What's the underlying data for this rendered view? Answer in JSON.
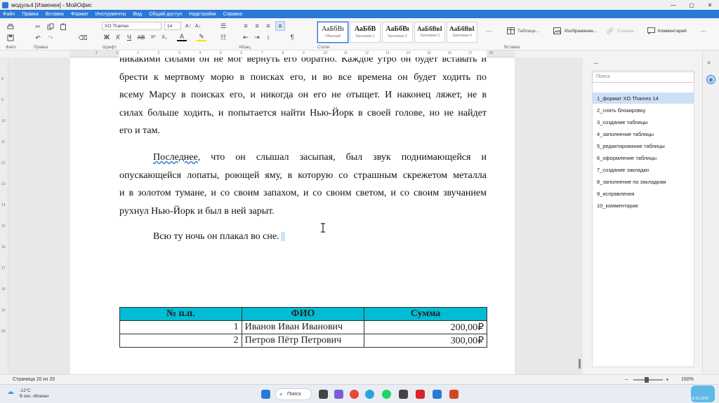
{
  "window": {
    "title": "модуль4 [Изменен] - МойОфис",
    "controls": [
      "—",
      "▢",
      "✕"
    ]
  },
  "menu": [
    "Файл",
    "Правка",
    "Вставка",
    "Формат",
    "Инструменты",
    "Вид",
    "Общий доступ",
    "Надстройки",
    "Справка"
  ],
  "ribbon": {
    "groups": {
      "file": "Файл",
      "edit": "Правка",
      "font": "Шрифт",
      "paragraph": "Абзац",
      "styles": "Стили",
      "insert": "Вставка"
    },
    "font_name": "XO Thames",
    "font_size": "14",
    "styles": [
      {
        "preview": "АаБбВı",
        "name": "Обычный"
      },
      {
        "preview": "АаБбВ",
        "name": "Заголовок 1"
      },
      {
        "preview": "АаБбВı",
        "name": "Заголовок 2"
      },
      {
        "preview": "АаБбВвI",
        "name": "Заголовок 3"
      },
      {
        "preview": "АаБбВвI",
        "name": "Заголовок 4"
      }
    ],
    "insert_table": "Таблица...",
    "insert_image": "Изображение...",
    "insert_link": "Ссылка...",
    "insert_comment": "Комментарий",
    "bold": "Ж",
    "italic": "К",
    "underline": "Ч",
    "strike": "АВ"
  },
  "ruler": {
    "h": [
      "2",
      "1",
      "1",
      "2",
      "3",
      "4",
      "5",
      "6",
      "7",
      "8",
      "9",
      "10",
      "11",
      "12",
      "13",
      "14",
      "15",
      "16",
      "17",
      "18"
    ],
    "v": [
      "8",
      "9",
      "10",
      "11",
      "12",
      "13",
      "14",
      "15",
      "16",
      "17",
      "18",
      "19",
      "20"
    ]
  },
  "document": {
    "para1": [
      "никакими силами он не мог вернуть его обратно. Каждое утро он будет вставать и",
      "брести к мертвому морю в поисках его, и во все времена он будет ходить по",
      "всему Марсу в поисках его, и никогда он его не отыщет. И наконец ляжет, не в",
      "силах больше ходить, и попытается найти Нью-Йорк в своей голове, но не найдет",
      "его и там."
    ],
    "para2": [
      "Последнее, что он слышал засыпая, был звук поднимающейся и",
      "опускающейся лопаты, роющей яму, в которую со страшным скрежетом металла",
      "и в золотом тумане, и со своим запахом, и со своим светом, и со своим звучанием",
      "рухнул Нью-Йорк и был в ней зарыт."
    ],
    "para3": "Всю ту ночь он плакал во сне.",
    "table": {
      "headers": [
        "№ п.п.",
        "ФИО",
        "Сумма"
      ],
      "rows": [
        [
          "1",
          "Иванов Иван Иванович",
          "200,00₽"
        ],
        [
          "2",
          "Петров Пётр Петрович",
          "300,00₽"
        ]
      ],
      "header_color": "#00bcd4"
    }
  },
  "sidepanel": {
    "search_placeholder": "Поиск",
    "bookmarks": [
      "1_формат XO Thames 14",
      "2_снять блокировку",
      "3_создание таблицы",
      "4_заполнение таблицы",
      "5_редактирование таблицы",
      "6_оформление таблицы",
      "7_создание закладки",
      "8_заполнение по закладкам",
      "9_исправления",
      "10_комментарии"
    ]
  },
  "status": {
    "page": "Страница 20 из 20",
    "zoom": "150%"
  },
  "taskbar": {
    "weather_temp": "-12°C",
    "weather_desc": "В осн. облачно",
    "search": "Поиск",
    "date": "15.02.2025"
  },
  "colors": {
    "accent": "#2b79d6",
    "table_header": "#00bcd4"
  }
}
